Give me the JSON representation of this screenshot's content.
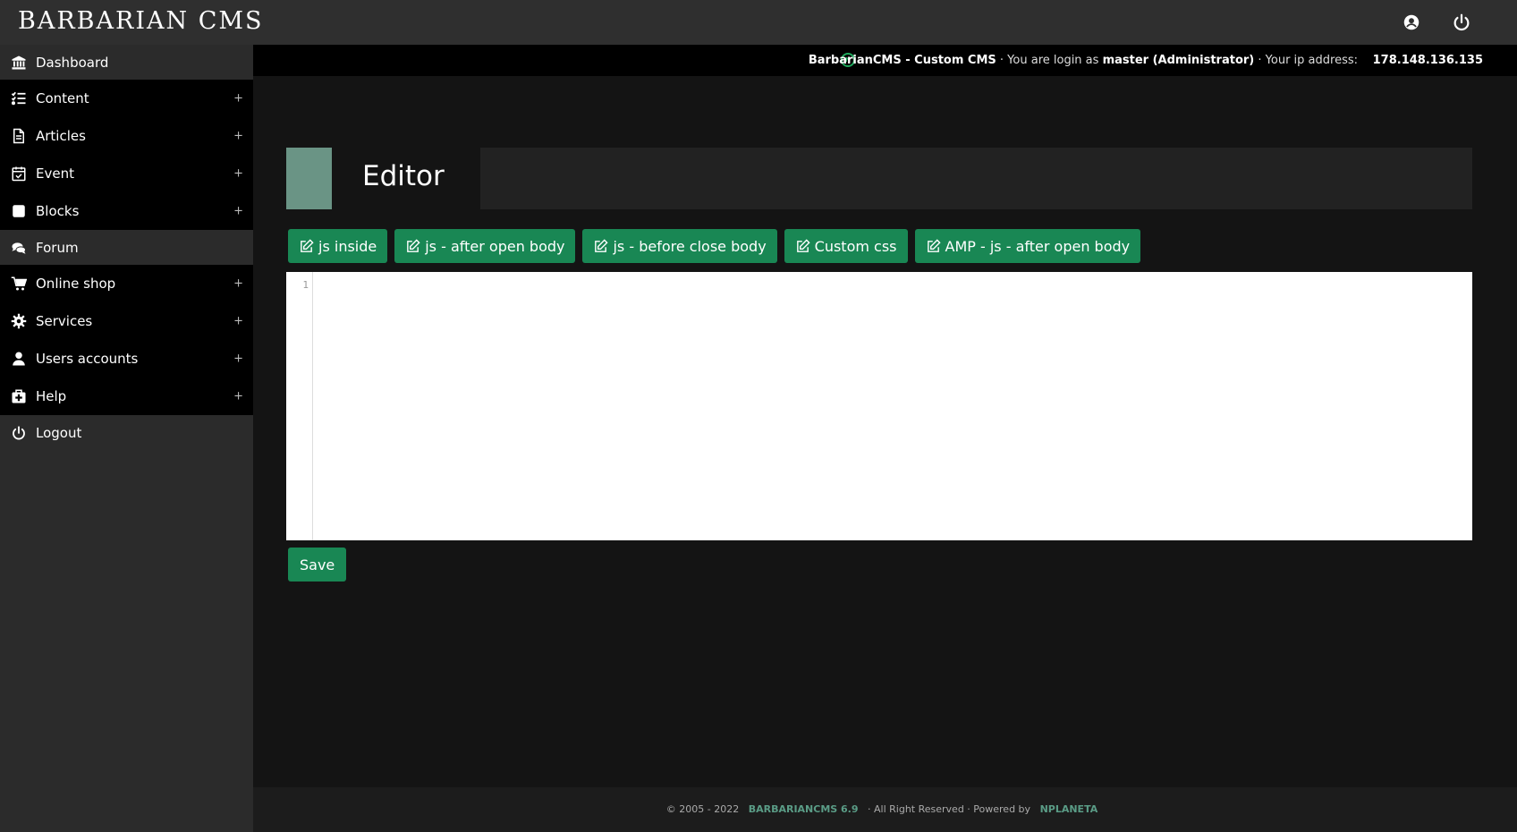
{
  "header": {
    "brand": "BARBARIAN CMS",
    "profile_icon": "user-circle-icon",
    "power_icon": "power-icon"
  },
  "sidebar": {
    "items": [
      {
        "label": "Dashboard",
        "icon": "bank-icon",
        "expandable": false
      },
      {
        "label": "Content",
        "icon": "list-check-icon",
        "expandable": true
      },
      {
        "label": "Articles",
        "icon": "file-icon",
        "expandable": true
      },
      {
        "label": "Event",
        "icon": "calendar-check-icon",
        "expandable": true
      },
      {
        "label": "Blocks",
        "icon": "square-icon",
        "expandable": true
      },
      {
        "label": "Forum",
        "icon": "comments-icon",
        "expandable": false
      },
      {
        "label": "Online shop",
        "icon": "cart-icon",
        "expandable": true
      },
      {
        "label": "Services",
        "icon": "gear-icon",
        "expandable": true
      },
      {
        "label": "Users accounts",
        "icon": "user-icon",
        "expandable": true
      },
      {
        "label": "Help",
        "icon": "medkit-icon",
        "expandable": true
      },
      {
        "label": "Logout",
        "icon": "power-icon",
        "expandable": false
      }
    ],
    "plus_symbol": "+"
  },
  "infobar": {
    "app_name": "BarbarianCMS - Custom CMS",
    "login_prefix": "· You are login as",
    "user": "master (Administrator)",
    "ip_prefix": "· Your ip address:",
    "ip": "178.148.136.135"
  },
  "main": {
    "title": "Editor",
    "tabs": [
      {
        "label": "js inside"
      },
      {
        "label": "js - after open body"
      },
      {
        "label": "js - before close body"
      },
      {
        "label": "Custom css"
      },
      {
        "label": "AMP - js - after open body"
      }
    ],
    "editor": {
      "line_number": "1",
      "content": ""
    },
    "save_label": "Save"
  },
  "footer": {
    "copyright": "© 2005 - 2022",
    "product": "BARBARIANCMS 6.9",
    "middle": "· All Right Reserved · Powered by",
    "vendor": "NPLANETA"
  },
  "colors": {
    "accent": "#198754",
    "title_block": "#6a9485",
    "footer_link": "#5a9c86"
  }
}
